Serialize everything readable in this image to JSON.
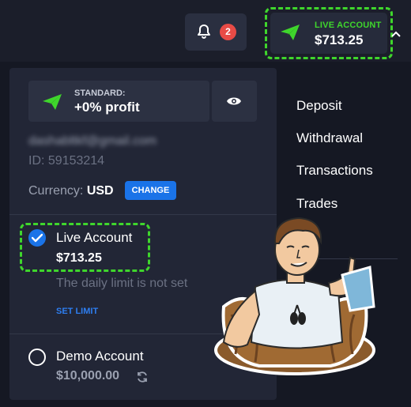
{
  "header": {
    "notifications_count": "2",
    "account_label": "LIVE ACCOUNT",
    "account_balance": "$713.25"
  },
  "profile": {
    "tier_label": "STANDARD:",
    "tier_value": "+0% profit",
    "email": "dashabltkf@gmail.com",
    "id_text": "ID: 59153214",
    "currency_label": "Currency:",
    "currency_value": "USD",
    "change_label": "CHANGE"
  },
  "accounts": {
    "live": {
      "name": "Live Account",
      "balance": "$713.25",
      "limit_text": "The daily limit is not set",
      "set_limit_label": "SET LIMIT"
    },
    "demo": {
      "name": "Demo Account",
      "balance": "$10,000.00"
    }
  },
  "menu": {
    "items": [
      "Deposit",
      "Withdrawal",
      "Transactions",
      "Trades"
    ]
  },
  "colors": {
    "accent_green": "#3fd62c",
    "accent_blue": "#1a73e8",
    "badge_red": "#e84b46"
  }
}
